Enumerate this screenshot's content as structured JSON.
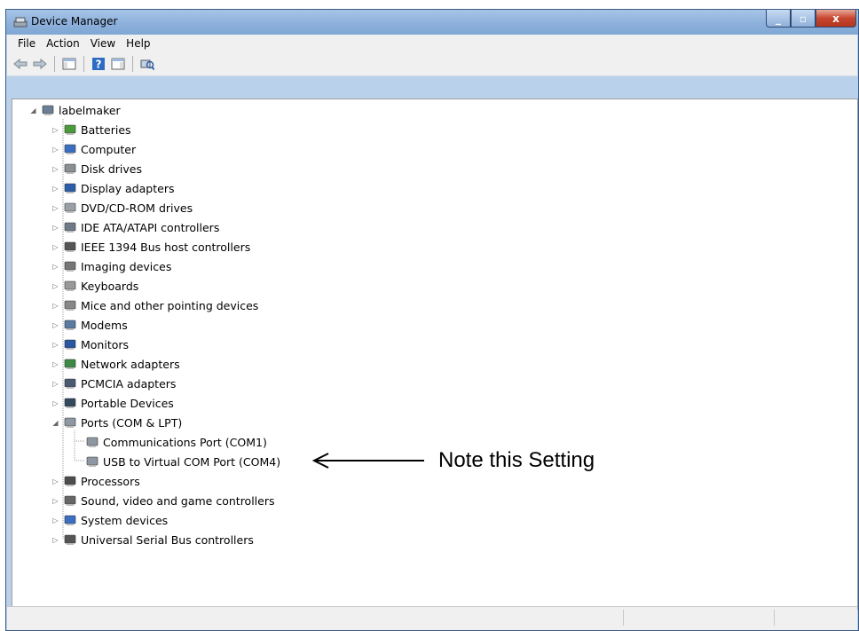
{
  "window": {
    "title": "Device Manager"
  },
  "caption": {
    "min": "_",
    "max": "▫",
    "close": "x"
  },
  "menu": [
    "File",
    "Action",
    "View",
    "Help"
  ],
  "tree": {
    "root": "labelmaker",
    "categories": [
      {
        "label": "Batteries",
        "icon": "battery-icon"
      },
      {
        "label": "Computer",
        "icon": "computer-icon"
      },
      {
        "label": "Disk drives",
        "icon": "disk-drive-icon"
      },
      {
        "label": "Display adapters",
        "icon": "display-adapter-icon"
      },
      {
        "label": "DVD/CD-ROM drives",
        "icon": "dvd-drive-icon"
      },
      {
        "label": "IDE ATA/ATAPI controllers",
        "icon": "ide-controller-icon"
      },
      {
        "label": "IEEE 1394 Bus host controllers",
        "icon": "ieee1394-icon"
      },
      {
        "label": "Imaging devices",
        "icon": "imaging-device-icon"
      },
      {
        "label": "Keyboards",
        "icon": "keyboard-icon"
      },
      {
        "label": "Mice and other pointing devices",
        "icon": "mouse-icon"
      },
      {
        "label": "Modems",
        "icon": "modem-icon"
      },
      {
        "label": "Monitors",
        "icon": "monitor-icon"
      },
      {
        "label": "Network adapters",
        "icon": "network-adapter-icon"
      },
      {
        "label": "PCMCIA adapters",
        "icon": "pcmcia-icon"
      },
      {
        "label": "Portable Devices",
        "icon": "portable-device-icon"
      },
      {
        "label": "Ports (COM & LPT)",
        "icon": "port-icon",
        "expanded": true,
        "children": [
          "Communications Port (COM1)",
          "USB to Virtual COM Port (COM4)"
        ]
      },
      {
        "label": "Processors",
        "icon": "processor-icon"
      },
      {
        "label": "Sound, video and game controllers",
        "icon": "sound-icon"
      },
      {
        "label": "System devices",
        "icon": "system-device-icon"
      },
      {
        "label": "Universal Serial Bus controllers",
        "icon": "usb-controller-icon"
      }
    ]
  },
  "annotation": {
    "text": "Note this Setting"
  }
}
